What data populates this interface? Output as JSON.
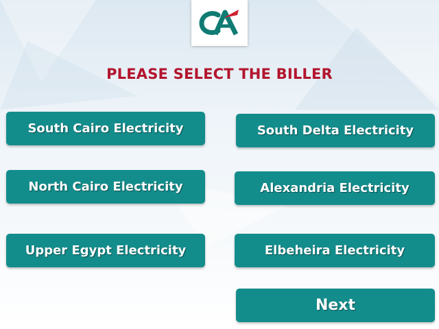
{
  "header": {
    "logo_icon": "credit-agricole-logo",
    "title": "PLEASE SELECT THE BILLER"
  },
  "billers": [
    {
      "label": "South Cairo Electricity"
    },
    {
      "label": "South Delta Electricity"
    },
    {
      "label": "North Cairo Electricity"
    },
    {
      "label": "Alexandria Electricity"
    },
    {
      "label": "Upper Egypt Electricity"
    },
    {
      "label": "Elbeheira Electricity"
    }
  ],
  "actions": {
    "next_label": "Next"
  },
  "colors": {
    "button": "#138d8c",
    "title": "#b3142d",
    "logo_green": "#0f7b73",
    "logo_red": "#d0202f"
  }
}
